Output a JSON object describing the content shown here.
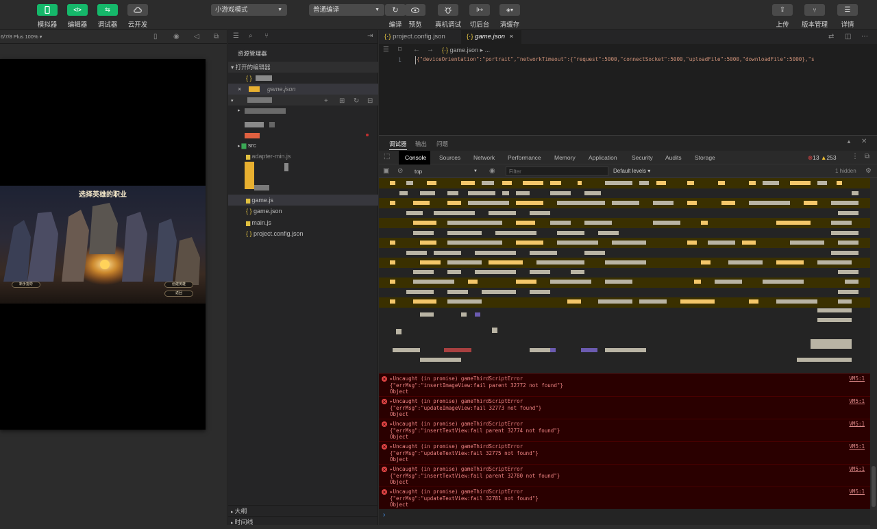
{
  "toolbar": {
    "simulator_label": "模拟器",
    "editor_label": "编辑器",
    "debugger_label": "调试器",
    "cloud_label": "云开发",
    "mode_select": "小游戏模式",
    "compile_select": "普通编译",
    "compile_label": "编译",
    "preview_label": "预览",
    "real_debug_label": "真机调试",
    "background_label": "切后台",
    "clear_cache_label": "清缓存",
    "upload_label": "上传",
    "version_label": "版本管理",
    "details_label": "详情",
    "accent": "#15b86a"
  },
  "simulator": {
    "device": "6/7/8 Plus 100% ▾",
    "game_title": "选择英雄的职业",
    "btn_left": "新手指导",
    "btn_right_top": "创建英雄",
    "btn_right_bottom": "返回"
  },
  "explorer": {
    "title": "资源管理器",
    "open_editors": "打开的编辑器",
    "open_file": "game.json",
    "files": [
      "src",
      "adapter-min.js",
      "game.js",
      "game.json",
      "main.js",
      "project.config.json"
    ],
    "outline": "大纲",
    "timeline": "时间线"
  },
  "editor": {
    "tabs": [
      "project.config.json",
      "game.json"
    ],
    "breadcrumb": "game.json",
    "breadcrumb_more": "...",
    "line_number": "1",
    "code": "{\"deviceOrientation\":\"portrait\",\"networkTimeout\":{\"request\":5000,\"connectSocket\":5000,\"uploadFile\":5000,\"downloadFile\":5000},\"s"
  },
  "debugger": {
    "panel_tabs": [
      "调试器",
      "输出",
      "问题"
    ],
    "tabs": [
      "Console",
      "Sources",
      "Network",
      "Performance",
      "Memory",
      "Application",
      "Security",
      "Audits",
      "Storage"
    ],
    "error_count": "13",
    "warning_count": "253",
    "context": "top",
    "filter_placeholder": "Filter",
    "levels": "Default levels ▾",
    "hidden": "1 hidden",
    "errors": [
      {
        "l1": "▸Uncaught (in promise) gameThirdScriptError",
        "l2": "{\"errMsg\":\"insertImageView:fail parent 32772 not found\"}",
        "l3": "Object",
        "src": "VM5:1"
      },
      {
        "l1": "▸Uncaught (in promise) gameThirdScriptError",
        "l2": "{\"errMsg\":\"updateImageView:fail 32773 not found\"}",
        "l3": "Object",
        "src": "VM5:1"
      },
      {
        "l1": "▸Uncaught (in promise) gameThirdScriptError",
        "l2": "{\"errMsg\":\"insertTextView:fail parent 32774 not found\"}",
        "l3": "Object",
        "src": "VM5:1"
      },
      {
        "l1": "▸Uncaught (in promise) gameThirdScriptError",
        "l2": "{\"errMsg\":\"updateTextView:fail 32775 not found\"}",
        "l3": "Object",
        "src": "VM5:1"
      },
      {
        "l1": "▸Uncaught (in promise) gameThirdScriptError",
        "l2": "{\"errMsg\":\"insertTextView:fail parent 32780 not found\"}",
        "l3": "Object",
        "src": "VM5:1"
      },
      {
        "l1": "▸Uncaught (in promise) gameThirdScriptError",
        "l2": "{\"errMsg\":\"updateTextView:fail 32781 not found\"}",
        "l3": "Object",
        "src": "VM5:1"
      }
    ],
    "prompt": "›"
  }
}
